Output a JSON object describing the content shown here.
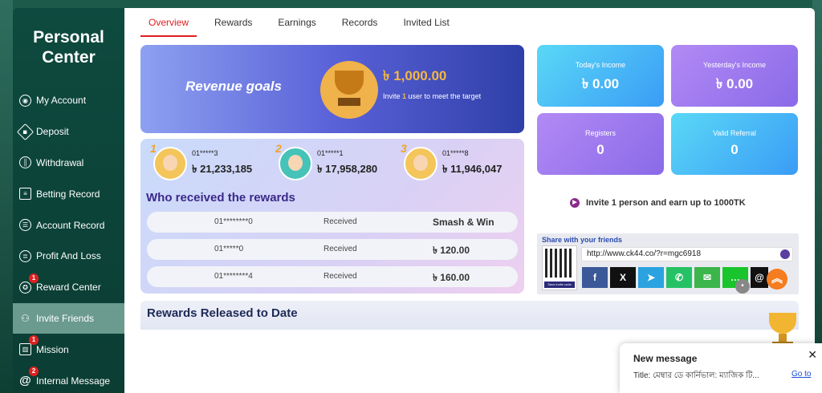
{
  "sidebar": {
    "title_line1": "Personal",
    "title_line2": "Center",
    "items": [
      {
        "label": "My Account",
        "icon": "account-icon",
        "badge": ""
      },
      {
        "label": "Deposit",
        "icon": "deposit-icon",
        "badge": ""
      },
      {
        "label": "Withdrawal",
        "icon": "withdrawal-icon",
        "badge": ""
      },
      {
        "label": "Betting Record",
        "icon": "document-icon",
        "badge": ""
      },
      {
        "label": "Account Record",
        "icon": "record-icon",
        "badge": ""
      },
      {
        "label": "Profit And Loss",
        "icon": "list-icon",
        "badge": ""
      },
      {
        "label": "Reward Center",
        "icon": "reward-icon",
        "badge": "1"
      },
      {
        "label": "Invite Friends",
        "icon": "invite-icon",
        "badge": ""
      },
      {
        "label": "Mission",
        "icon": "gift-icon",
        "badge": "1"
      },
      {
        "label": "Internal Message",
        "icon": "at-icon",
        "badge": "2"
      }
    ]
  },
  "tabs": [
    "Overview",
    "Rewards",
    "Earnings",
    "Records",
    "Invited List"
  ],
  "revenue": {
    "label": "Revenue goals",
    "amount": "৳ 1,000.00",
    "sub_prefix": "Invite ",
    "sub_count": "1",
    "sub_suffix": " user to meet the target"
  },
  "stats": {
    "todays_income_label": "Today's Income",
    "todays_income_value": "৳ 0.00",
    "yesterdays_income_label": "Yesterday's Income",
    "yesterdays_income_value": "৳ 0.00",
    "registers_label": "Registers",
    "registers_value": "0",
    "valid_referral_label": "Valid Referral",
    "valid_referral_value": "0"
  },
  "top3": [
    {
      "rank": "1",
      "id": "01*****3",
      "amount": "৳ 21,233,185"
    },
    {
      "rank": "2",
      "id": "01*****1",
      "amount": "৳ 17,958,280"
    },
    {
      "rank": "3",
      "id": "01*****8",
      "amount": "৳ 11,946,047"
    }
  ],
  "who_received": "Who received the rewards",
  "reward_rows": [
    {
      "user": "01********0",
      "status": "Received",
      "amount": "Smash & Win"
    },
    {
      "user": "01*****0",
      "status": "Received",
      "amount": "৳ 120.00"
    },
    {
      "user": "01********4",
      "status": "Received",
      "amount": "৳ 160.00"
    }
  ],
  "invite_text": "Invite 1 person and earn up to 1000TK",
  "share": {
    "title": "Share with your friends",
    "url": "http://www.ck44.co/?r=mgc6918",
    "qr_button": "Save invite code",
    "socials": [
      {
        "name": "facebook-icon",
        "glyph": "f",
        "color": "#3b5998"
      },
      {
        "name": "x-icon",
        "glyph": "𝕏",
        "color": "#111111"
      },
      {
        "name": "telegram-icon",
        "glyph": "➤",
        "color": "#2aa3e0"
      },
      {
        "name": "whatsapp-icon",
        "glyph": "✆",
        "color": "#25c265"
      },
      {
        "name": "sms-icon",
        "glyph": "✉",
        "color": "#3cb54a"
      },
      {
        "name": "line-icon",
        "glyph": "…",
        "color": "#19c42c"
      },
      {
        "name": "threads-icon",
        "glyph": "@",
        "color": "#111111"
      }
    ]
  },
  "released_title": "Rewards Released to Date",
  "toast": {
    "title": "New message",
    "body": "Title: মেম্বার ডে কার্নিভাল: ম্যাজিক টি...",
    "link": "Go to"
  }
}
